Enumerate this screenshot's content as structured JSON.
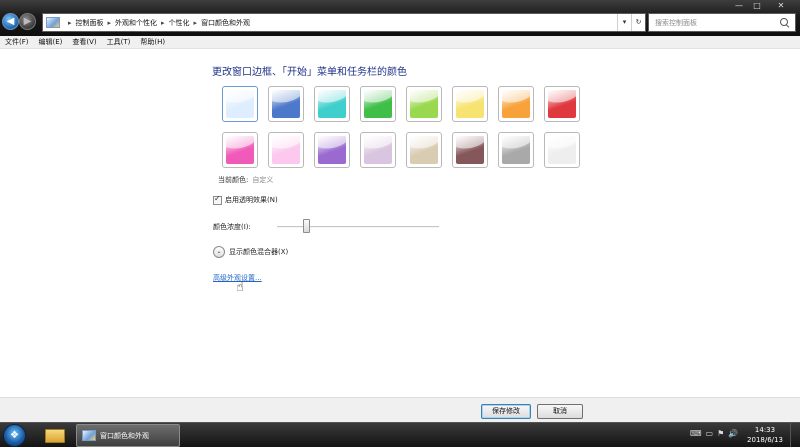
{
  "window": {
    "caption": {
      "minimize": "—",
      "maximize": "□",
      "close": "✕"
    },
    "nav": {
      "back": "◀",
      "forward": "▶",
      "dropdown": "▾"
    },
    "breadcrumb": [
      "控制面板",
      "外观和个性化",
      "个性化",
      "窗口颜色和外观"
    ],
    "breadcrumb_sep": "▸",
    "address_dropdown": "▾",
    "refresh_glyph": "↻",
    "search_placeholder": "搜索控制面板"
  },
  "menu": [
    "文件(F)",
    "编辑(E)",
    "查看(V)",
    "工具(T)",
    "帮助(H)"
  ],
  "main": {
    "title": "更改窗口边框、「开始」菜单和任务栏的颜色",
    "swatches": [
      {
        "name": "sky",
        "color": "#dfeeff"
      },
      {
        "name": "twilight",
        "color": "#4c79c9"
      },
      {
        "name": "sea",
        "color": "#3fcfcc"
      },
      {
        "name": "leaf",
        "color": "#3fbf48"
      },
      {
        "name": "lime",
        "color": "#9ad84f"
      },
      {
        "name": "pumpkin-light",
        "color": "#f7e372"
      },
      {
        "name": "pumpkin",
        "color": "#f7a23a"
      },
      {
        "name": "ruby",
        "color": "#e0383f"
      },
      {
        "name": "fuchsia",
        "color": "#f05ab8"
      },
      {
        "name": "blush",
        "color": "#fcc8ee"
      },
      {
        "name": "violet",
        "color": "#9a6ad0"
      },
      {
        "name": "lavender",
        "color": "#d9c5df"
      },
      {
        "name": "taupe",
        "color": "#d8ccb2"
      },
      {
        "name": "chocolate",
        "color": "#85575a"
      },
      {
        "name": "slate",
        "color": "#a9a9a9"
      },
      {
        "name": "frost",
        "color": "#eeeeee"
      }
    ],
    "selected_swatch": 0,
    "current_color_label": "当前颜色:",
    "current_color_value": "自定义",
    "transparency_label": "启用透明效果(N)",
    "transparency_checked": true,
    "intensity_label": "颜色浓度(I):",
    "intensity_level": 0.18,
    "mixer_label": "显示颜色混合器(X)",
    "mixer_expand_glyph": "⌄",
    "advanced_link": "高级外观设置...",
    "cursor_glyph": "☝"
  },
  "footer": {
    "save": "保存修改",
    "cancel": "取消"
  },
  "taskbar": {
    "start_glyph": "❖",
    "active_task": "窗口颜色和外观",
    "tray_icons": [
      "⌨",
      "▭",
      "⚑",
      "🔊"
    ],
    "time": "14:33",
    "date": "2018/6/13"
  }
}
